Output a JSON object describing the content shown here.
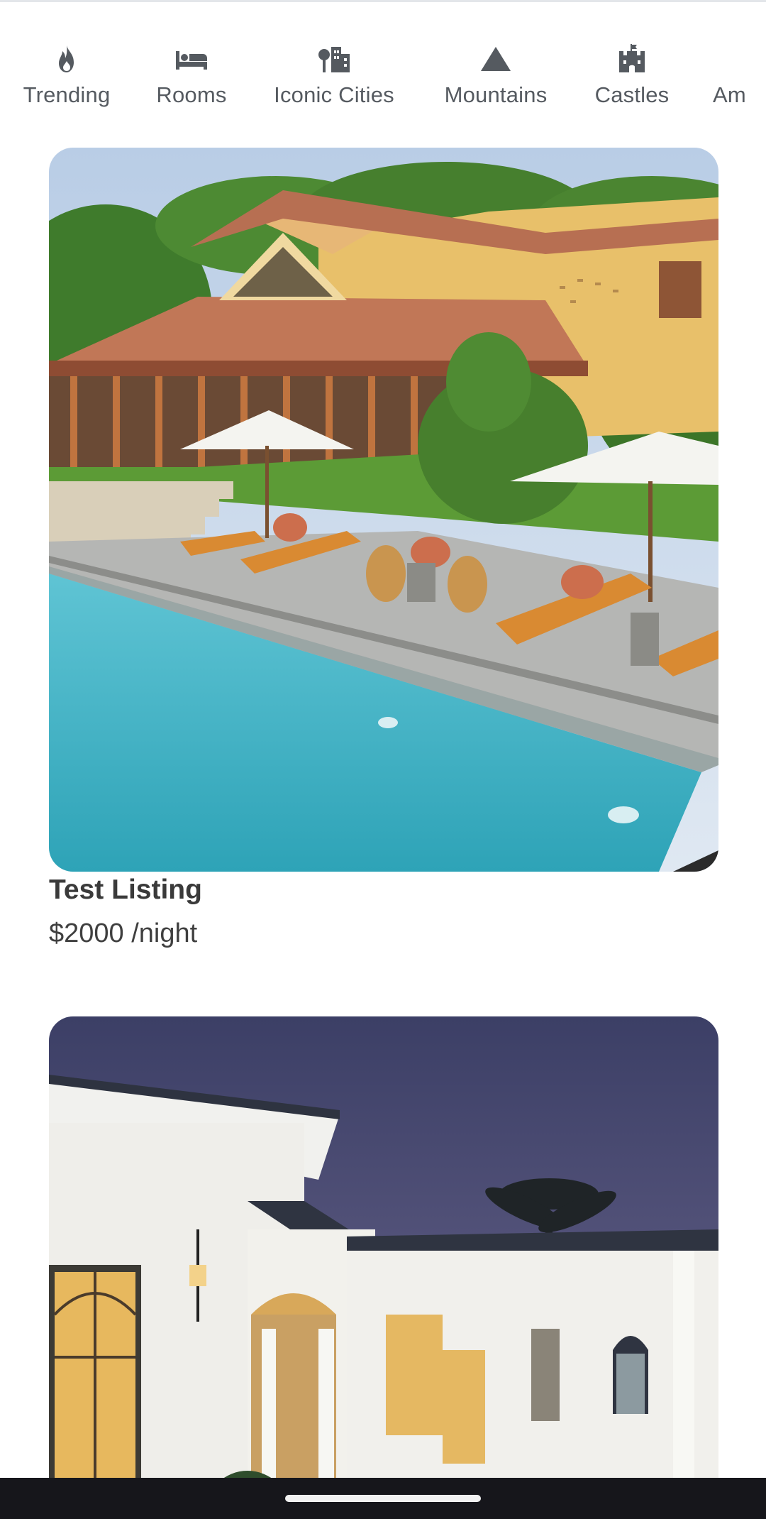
{
  "categories": [
    {
      "label": "Trending",
      "icon": "fire-icon"
    },
    {
      "label": "Rooms",
      "icon": "bed-icon"
    },
    {
      "label": "Iconic Cities",
      "icon": "city-icon"
    },
    {
      "label": "Mountains",
      "icon": "mountain-icon"
    },
    {
      "label": "Castles",
      "icon": "castle-icon"
    },
    {
      "label": "Am",
      "icon": ""
    }
  ],
  "listings": [
    {
      "title": "Test Listing",
      "price": "$2000 /night",
      "photo": "villa with swimming pool and lounge chairs"
    },
    {
      "photo": "white colonial villa at dusk"
    }
  ],
  "colors": {
    "category_text": "#555a60",
    "navbar": "#16161b"
  }
}
